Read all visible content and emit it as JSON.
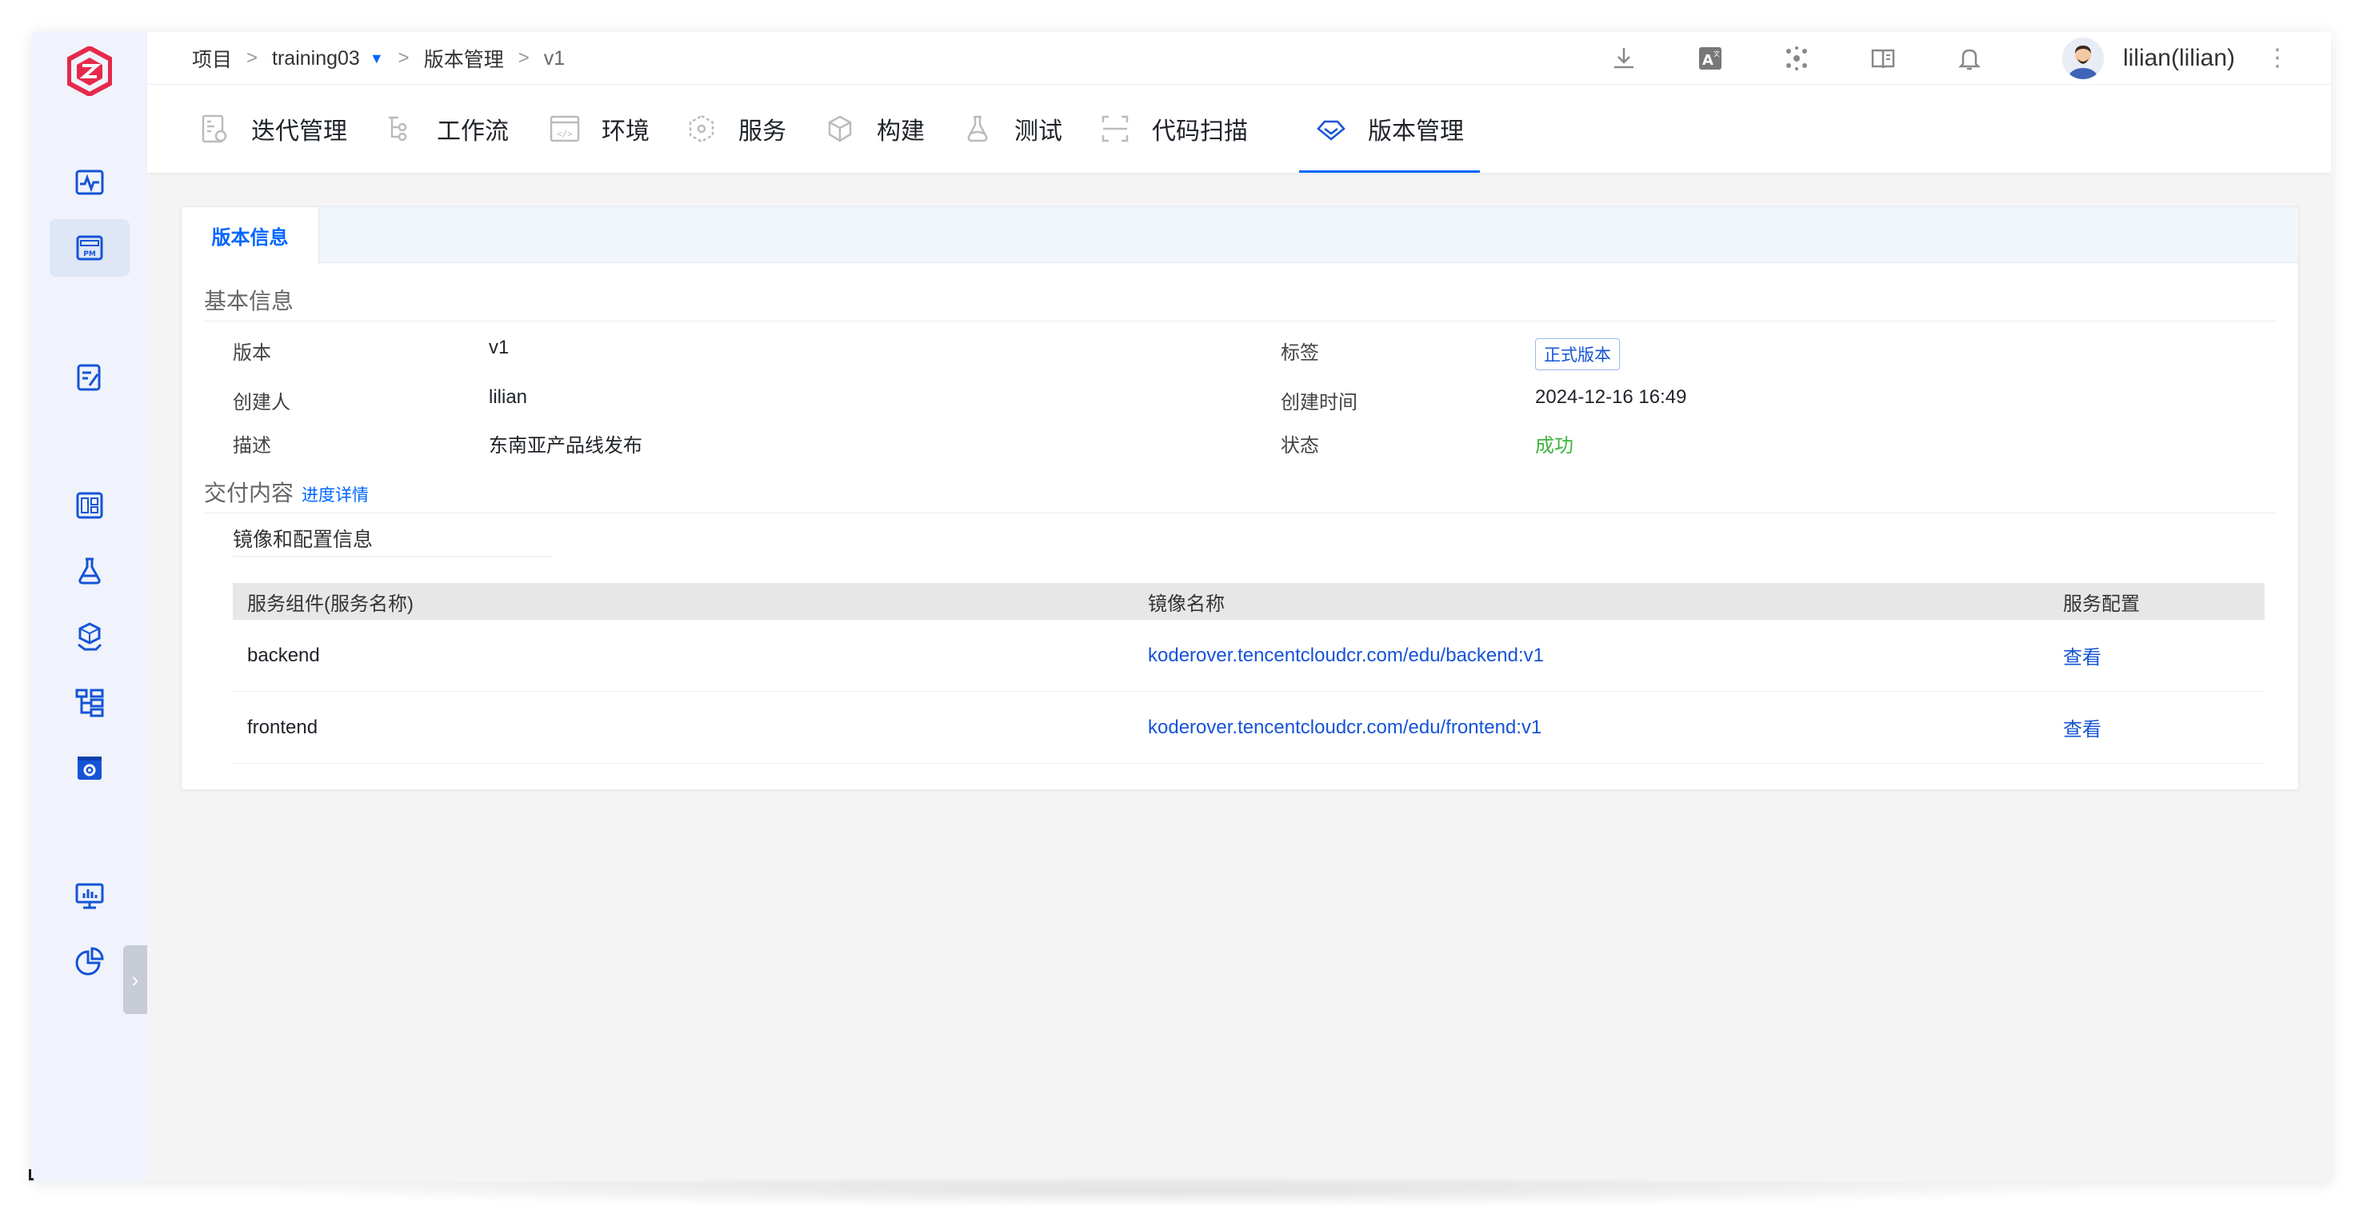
{
  "breadcrumb": {
    "project": "项目",
    "sep1": ">",
    "project_name": "training03",
    "sep2": ">",
    "section": "版本管理",
    "sep3": ">",
    "version": "v1"
  },
  "user": {
    "name": "lilian(lilian)"
  },
  "top_icons": [
    "download-icon",
    "translate-icon",
    "network-icon",
    "book-icon",
    "bell-icon"
  ],
  "nav": {
    "tabs": [
      {
        "label": "迭代管理",
        "icon": "iteration-icon"
      },
      {
        "label": "工作流",
        "icon": "workflow-icon"
      },
      {
        "label": "环境",
        "icon": "environment-icon"
      },
      {
        "label": "服务",
        "icon": "service-icon"
      },
      {
        "label": "构建",
        "icon": "build-icon"
      },
      {
        "label": "测试",
        "icon": "test-icon"
      },
      {
        "label": "代码扫描",
        "icon": "scan-icon"
      },
      {
        "label": "版本管理",
        "icon": "version-icon",
        "active": true
      }
    ]
  },
  "card": {
    "tab": "版本信息",
    "basic": {
      "title": "基本信息",
      "version_label": "版本",
      "version_value": "v1",
      "tag_label": "标签",
      "tag_value": "正式版本",
      "creator_label": "创建人",
      "creator_value": "lilian",
      "created_label": "创建时间",
      "created_value": "2024-12-16 16:49",
      "desc_label": "描述",
      "desc_value": "东南亚产品线发布",
      "status_label": "状态",
      "status_value": "成功"
    },
    "delivery": {
      "title": "交付内容",
      "progress_link": "进度详情",
      "subsection": "镜像和配置信息",
      "columns": [
        "服务组件(服务名称)",
        "镜像名称",
        "服务配置"
      ],
      "rows": [
        {
          "component": "backend",
          "image": "koderover.tencentcloudcr.com/edu/backend:v1",
          "config": "查看"
        },
        {
          "component": "frontend",
          "image": "koderover.tencentcloudcr.com/edu/frontend:v1",
          "config": "查看"
        }
      ]
    }
  },
  "colors": {
    "accent": "#0066ff",
    "success": "#3cb43c",
    "sidebar_bg": "#f0f3fb",
    "logo": "#e6294b"
  }
}
